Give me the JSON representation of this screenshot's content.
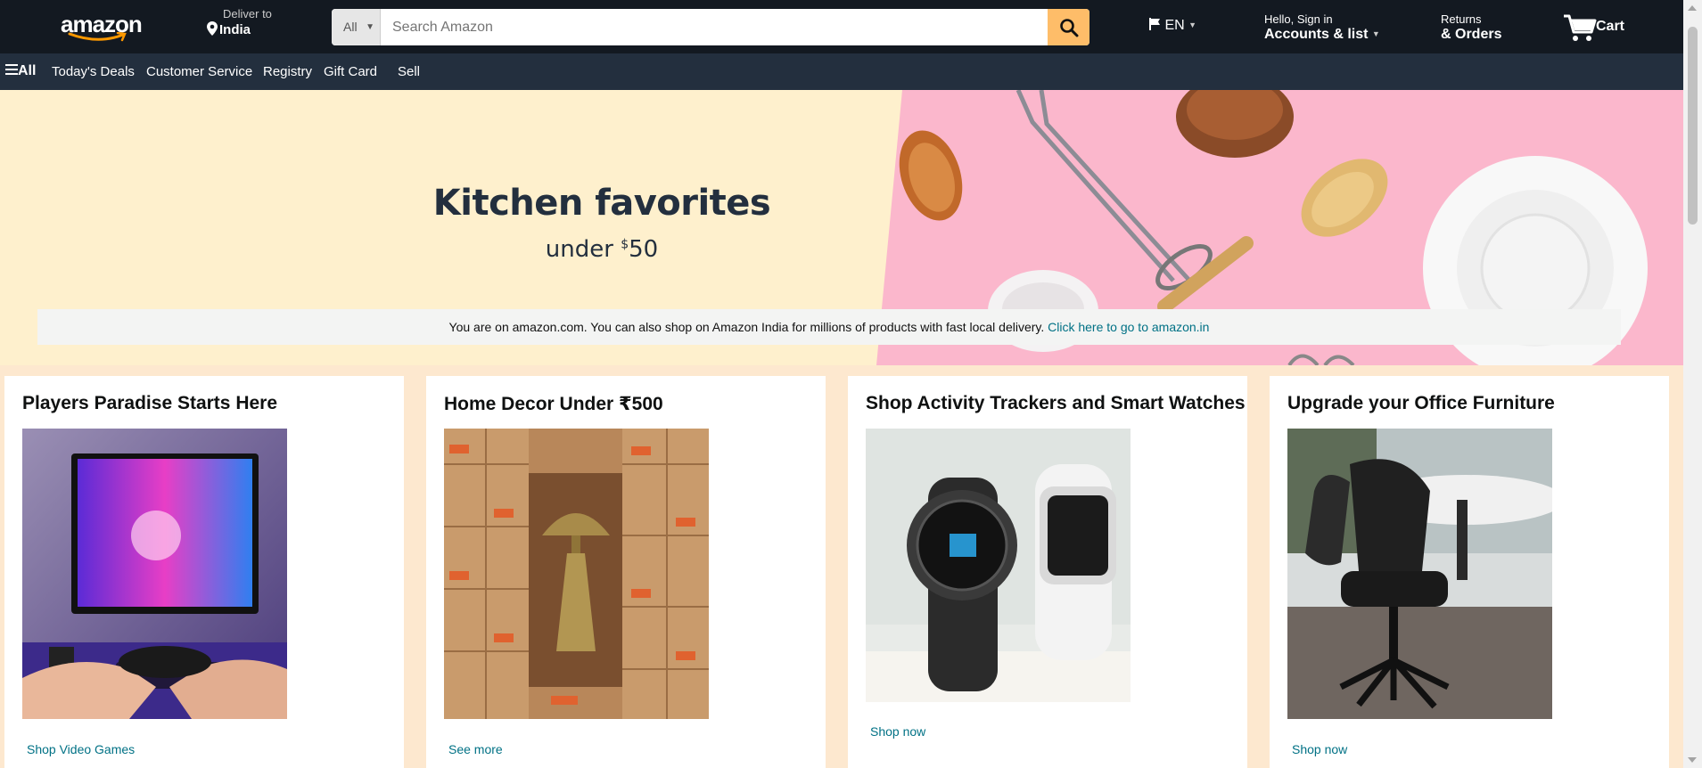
{
  "header": {
    "logo_text": "amazon",
    "deliver_small": "Deliver to",
    "deliver_location": "India",
    "search_category": "All",
    "search_placeholder": "Search Amazon",
    "language": "EN",
    "account_small": "Hello, Sign in",
    "account_big": "Accounts & list",
    "orders_small": "Returns",
    "orders_big": "& Orders",
    "cart_label": "Cart"
  },
  "subnav": {
    "all_label": "All",
    "items": [
      "Today's Deals",
      "Customer Service",
      "Registry",
      "Gift Card",
      "Sell"
    ]
  },
  "hero": {
    "title": "Kitchen favorites",
    "subtitle_prefix": "under ",
    "currency": "$",
    "amount": "50"
  },
  "notice": {
    "text": "You are on amazon.com. You can also shop on Amazon India for millions of products with fast local delivery. ",
    "link": "Click here to go to amazon.in"
  },
  "cards": [
    {
      "title": "Players Paradise Starts Here",
      "link": "Shop Video Games"
    },
    {
      "title": "Home Decor Under ₹500",
      "link": "See more"
    },
    {
      "title": "Shop Activity Trackers and Smart Watches",
      "link": "Shop now"
    },
    {
      "title": "Upgrade your Office Furniture",
      "link": "Shop now"
    }
  ],
  "colors": {
    "nav_bg": "#131921",
    "subnav_bg": "#232f3e",
    "search_button": "#febd69",
    "hero_left": "#fef0cd",
    "hero_right": "#fbb7cc",
    "link": "#007185",
    "page_bg": "#fde8cf"
  }
}
